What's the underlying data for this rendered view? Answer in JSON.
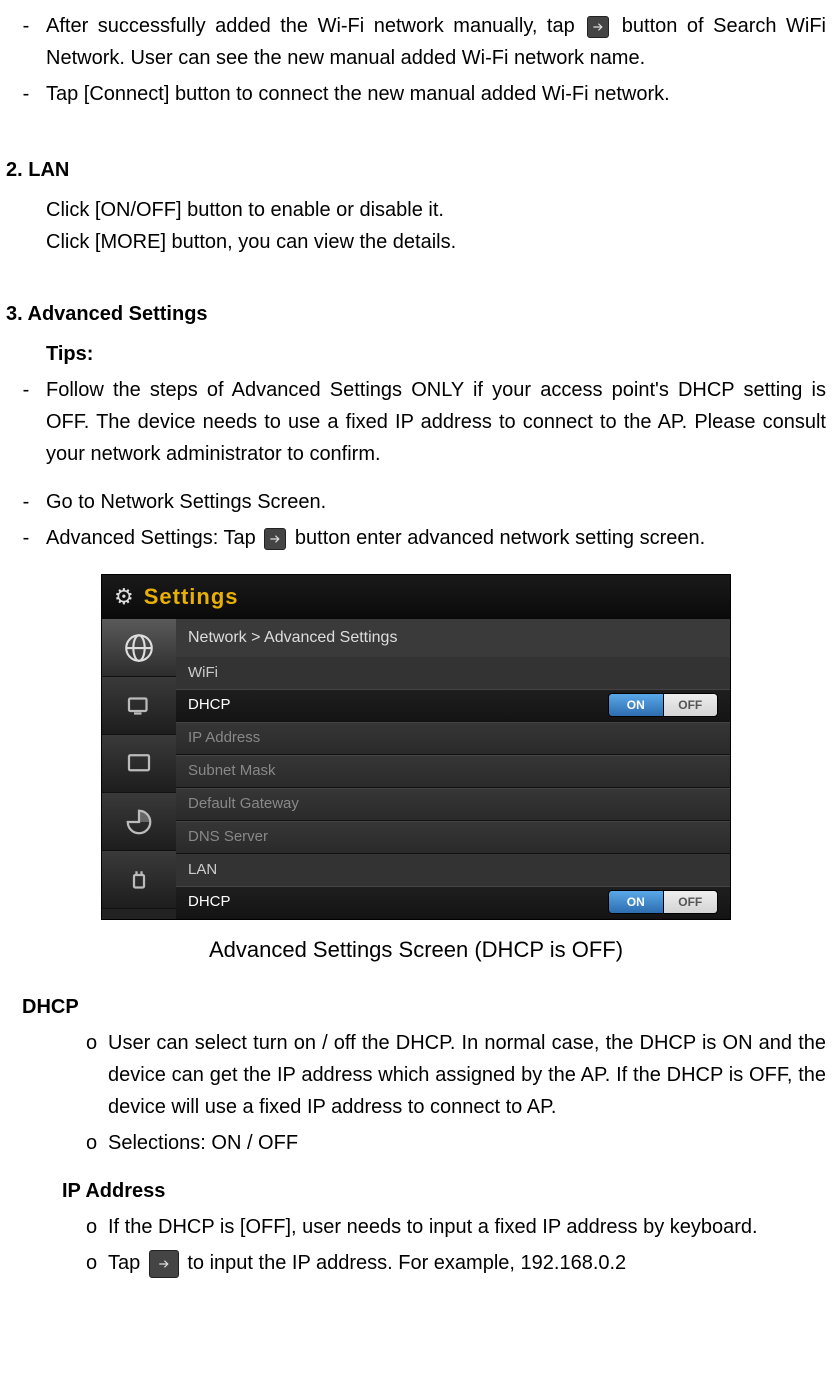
{
  "line1_pre": "After successfully added the Wi-Fi network manually, tap",
  "line1_post": "button of Search WiFi Network. User can see the new manual added Wi-Fi network name.",
  "line2": "Tap [Connect] button to connect the new manual added Wi-Fi network.",
  "sec2_heading": "2. LAN",
  "sec2_l1": "Click [ON/OFF] button to enable or disable it.",
  "sec2_l2": "Click [MORE] button, you can view the details.",
  "sec3_heading": "3. Advanced Settings",
  "sec3_tips": "Tips:",
  "sec3_b1": "Follow the steps of Advanced Settings ONLY if your access point's DHCP setting is OFF. The device needs to use a fixed IP address to connect to the AP.  Please consult your network administrator to confirm.",
  "sec3_b2": "Go to Network Settings Screen.",
  "sec3_b3_pre": "Advanced Settings: Tap",
  "sec3_b3_post": "button enter advanced network setting screen.",
  "ss": {
    "title": "Settings",
    "breadcrumb": "Network > Advanced Settings",
    "wifi_label": "WiFi",
    "lan_label": "LAN",
    "rows": {
      "dhcp": "DHCP",
      "ip": "IP Address",
      "subnet": "Subnet Mask",
      "gateway": "Default Gateway",
      "dns": "DNS Server"
    },
    "toggle_on": "ON",
    "toggle_off": "OFF"
  },
  "caption": "Advanced Settings Screen (DHCP is OFF)",
  "dhcp_heading": "DHCP",
  "dhcp_o1": "User can select turn on / off the DHCP. In normal case, the DHCP is ON and the device can get the IP address which assigned by the AP. If the DHCP is OFF, the device will use a fixed IP address to connect to AP.",
  "dhcp_o2": "Selections: ON / OFF",
  "ip_heading": "IP Address",
  "ip_o1": "If the DHCP is [OFF], user needs to input a fixed IP address by keyboard.",
  "ip_o2_pre": "Tap",
  "ip_o2_post": "to input the IP address. For example, 192.168.0.2"
}
